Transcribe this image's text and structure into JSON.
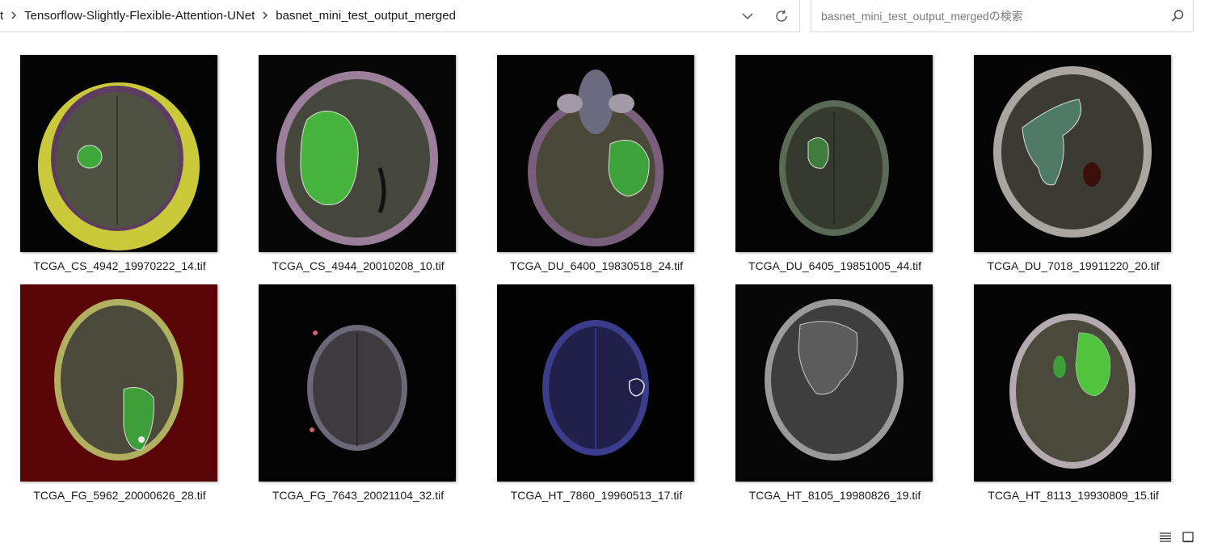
{
  "breadcrumb": {
    "items": [
      {
        "label": "t"
      },
      {
        "label": "Tensorflow-Slightly-Flexible-Attention-UNet"
      },
      {
        "label": "basnet_mini_test_output_merged"
      }
    ]
  },
  "search": {
    "placeholder": "basnet_mini_test_output_mergedの検索"
  },
  "icons": {
    "separator": "chevron-right-icon",
    "history": "chevron-down-icon",
    "refresh": "refresh-icon",
    "search": "search-icon",
    "details_view": "details-view-icon",
    "large_icons_view": "large-icons-view-icon"
  },
  "files": [
    {
      "name": "TCGA_CS_4942_19970222_14.tif",
      "bg": "#030303",
      "tumor": "#3fa83a"
    },
    {
      "name": "TCGA_CS_4944_20010208_10.tif",
      "bg": "#060606",
      "tumor": "#46b43c"
    },
    {
      "name": "TCGA_DU_6400_19830518_24.tif",
      "bg": "#040404",
      "tumor": "#3da23a"
    },
    {
      "name": "TCGA_DU_6405_19851005_44.tif",
      "bg": "#040404",
      "tumor": "#3e7d3c"
    },
    {
      "name": "TCGA_DU_7018_19911220_20.tif",
      "bg": "#050505",
      "tumor": "#4f7a66"
    },
    {
      "name": "TCGA_FG_5962_20000626_28.tif",
      "bg": "#5a0505",
      "tumor": "#3e9e3a"
    },
    {
      "name": "TCGA_FG_7643_20021104_32.tif",
      "bg": "#030303",
      "tumor": ""
    },
    {
      "name": "TCGA_HT_7860_19960513_17.tif",
      "bg": "#020202",
      "tumor": "#20204a"
    },
    {
      "name": "TCGA_HT_8105_19980826_19.tif",
      "bg": "#060606",
      "tumor": "#5c5c5c"
    },
    {
      "name": "TCGA_HT_8113_19930809_15.tif",
      "bg": "#050505",
      "tumor": "#4fc43c"
    }
  ]
}
